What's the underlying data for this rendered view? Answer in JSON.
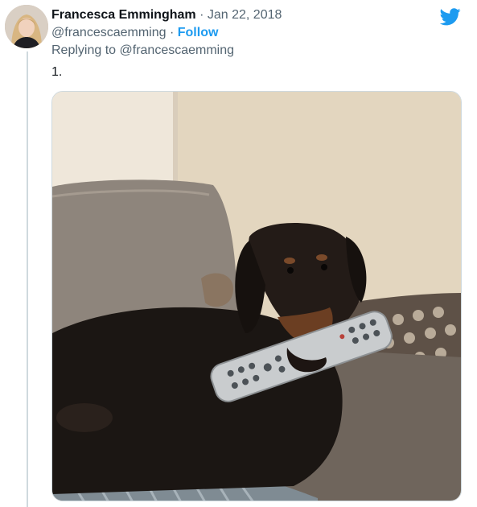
{
  "tweet": {
    "display_name": "Francesca Emmingham",
    "separator": "·",
    "date": "Jan 22, 2018",
    "handle": "@francescaemming",
    "follow_label": "Follow",
    "replying_prefix": "Replying to",
    "replying_handle": "@francescaemming",
    "text": "1."
  },
  "icons": {
    "brand": "twitter-bird-icon"
  },
  "colors": {
    "accent": "#1d9bf0",
    "secondary_text": "#536471",
    "primary_text": "#0f1419"
  }
}
